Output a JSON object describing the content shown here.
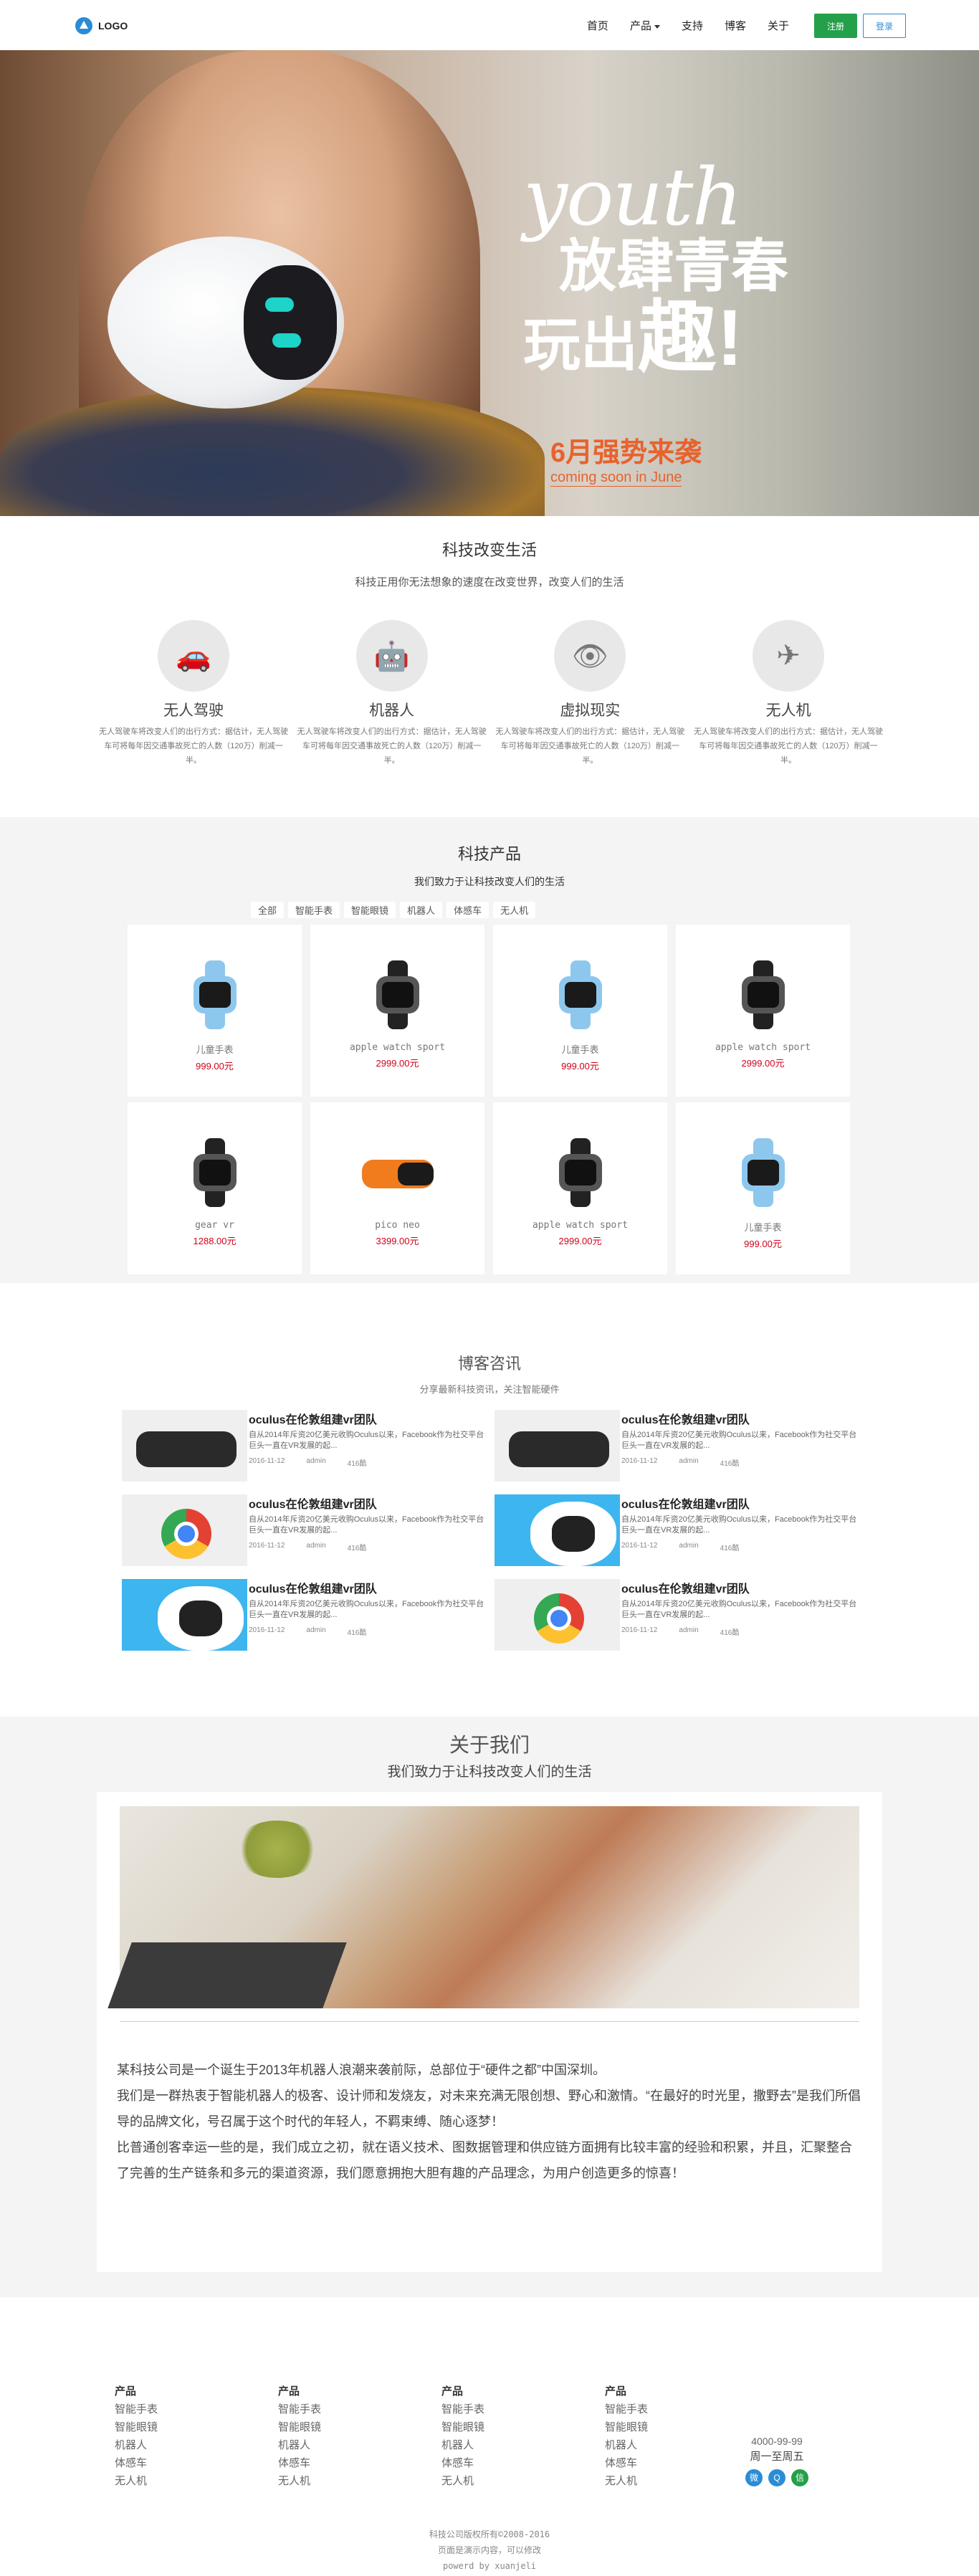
{
  "nav": {
    "logo": "LOGO",
    "items": [
      {
        "label": "首页",
        "dropdown": false
      },
      {
        "label": "产品",
        "dropdown": true
      },
      {
        "label": "支持",
        "dropdown": false
      },
      {
        "label": "博客",
        "dropdown": false
      },
      {
        "label": "关于",
        "dropdown": false
      }
    ],
    "register": "注册",
    "login": "登录"
  },
  "hero": {
    "youth": "youth",
    "line1": "放肆青春",
    "line2a": "玩出",
    "line2b": "趣!",
    "month": "6月强势来袭",
    "coming": "coming soon in June"
  },
  "features": {
    "title": "科技改变生活",
    "subtitle": "科技正用你无法想象的速度在改变世界，改变人们的生活",
    "items": [
      {
        "icon": "car-icon",
        "name": "无人驾驶",
        "desc": "无人驾驶车将改变人们的出行方式：据估计，无人驾驶车可将每年因交通事故死亡的人数（120万）削减一半。"
      },
      {
        "icon": "android-icon",
        "name": "机器人",
        "desc": "无人驾驶车将改变人们的出行方式：据估计，无人驾驶车可将每年因交通事故死亡的人数（120万）削减一半。"
      },
      {
        "icon": "eye-icon",
        "name": "虚拟现实",
        "desc": "无人驾驶车将改变人们的出行方式：据估计，无人驾驶车可将每年因交通事故死亡的人数（120万）削减一半。"
      },
      {
        "icon": "plane-icon",
        "name": "无人机",
        "desc": "无人驾驶车将改变人们的出行方式：据估计，无人驾驶车可将每年因交通事故死亡的人数（120万）削减一半。"
      }
    ]
  },
  "products": {
    "title": "科技产品",
    "subtitle": "我们致力于让科技改变人们的生活",
    "tabs": [
      "全部",
      "智能手表",
      "智能眼镜",
      "机器人",
      "体感车",
      "无人机"
    ],
    "items": [
      {
        "name": "儿童手表",
        "price": "999.00元",
        "kind": "kids-watch"
      },
      {
        "name": "apple watch sport",
        "price": "2999.00元",
        "kind": "apple-watch"
      },
      {
        "name": "儿童手表",
        "price": "999.00元",
        "kind": "kids-watch"
      },
      {
        "name": "apple watch sport",
        "price": "2999.00元",
        "kind": "apple-watch"
      },
      {
        "name": "gear vr",
        "price": "1288.00元",
        "kind": "apple-watch"
      },
      {
        "name": "pico neo",
        "price": "3399.00元",
        "kind": "vr-headset"
      },
      {
        "name": "apple watch sport",
        "price": "2999.00元",
        "kind": "apple-watch"
      },
      {
        "name": "儿童手表",
        "price": "999.00元",
        "kind": "kids-watch"
      }
    ]
  },
  "blog": {
    "title": "博客咨讯",
    "subtitle": "分享最新科技资讯，关注智能硬件",
    "posts": [
      {
        "title": "oculus在伦敦组建vr团队",
        "desc": "自从2014年斥资20亿美元收购Oculus以来，Facebook作为社交平台巨头一直在VR发展的起...",
        "date": "2016-11-12",
        "author": "admin",
        "views": "416酷",
        "thumb": "vr"
      },
      {
        "title": "oculus在伦敦组建vr团队",
        "desc": "自从2014年斥资20亿美元收购Oculus以来，Facebook作为社交平台巨头一直在VR发展的起...",
        "date": "2016-11-12",
        "author": "admin",
        "views": "416酷",
        "thumb": "vr"
      },
      {
        "title": "oculus在伦敦组建vr团队",
        "desc": "自从2014年斥资20亿美元收购Oculus以来，Facebook作为社交平台巨头一直在VR发展的起...",
        "date": "2016-11-12",
        "author": "admin",
        "views": "416酷",
        "thumb": "chrome"
      },
      {
        "title": "oculus在伦敦组建vr团队",
        "desc": "自从2014年斥资20亿美元收购Oculus以来，Facebook作为社交平台巨头一直在VR发展的起...",
        "date": "2016-11-12",
        "author": "admin",
        "views": "416酷",
        "thumb": "robot"
      },
      {
        "title": "oculus在伦敦组建vr团队",
        "desc": "自从2014年斥资20亿美元收购Oculus以来，Facebook作为社交平台巨头一直在VR发展的起...",
        "date": "2016-11-12",
        "author": "admin",
        "views": "416酷",
        "thumb": "robot"
      },
      {
        "title": "oculus在伦敦组建vr团队",
        "desc": "自从2014年斥资20亿美元收购Oculus以来，Facebook作为社交平台巨头一直在VR发展的起...",
        "date": "2016-11-12",
        "author": "admin",
        "views": "416酷",
        "thumb": "chrome"
      }
    ]
  },
  "about": {
    "title": "关于我们",
    "subtitle": "我们致力于让科技改变人们的生活",
    "paragraphs": [
      "某科技公司是一个诞生于2013年机器人浪潮来袭前际，总部位于“硬件之都”中国深圳。",
      "我们是一群热衷于智能机器人的极客、设计师和发烧友，对未来充满无限创想、野心和激情。“在最好的时光里，撒野去”是我们所倡导的品牌文化，号召属于这个时代的年轻人，不羁束缚、随心逐梦！",
      "比普通创客幸运一些的是，我们成立之初，就在语义技术、图数据管理和供应链方面拥有比较丰富的经验和积累，并且，汇聚整合了完善的生产链条和多元的渠道资源，我们愿意拥抱大胆有趣的产品理念，为用户创造更多的惊喜！"
    ]
  },
  "footer": {
    "columns": [
      {
        "head": "产品",
        "links": [
          "智能手表",
          "智能眼镜",
          "机器人",
          "体感车",
          "无人机"
        ]
      },
      {
        "head": "产品",
        "links": [
          "智能手表",
          "智能眼镜",
          "机器人",
          "体感车",
          "无人机"
        ]
      },
      {
        "head": "产品",
        "links": [
          "智能手表",
          "智能眼镜",
          "机器人",
          "体感车",
          "无人机"
        ]
      },
      {
        "head": "产品",
        "links": [
          "智能手表",
          "智能眼镜",
          "机器人",
          "体感车",
          "无人机"
        ]
      }
    ],
    "phone": "4000-99-99",
    "hours": "周一至周五",
    "social": [
      {
        "icon": "weibo-icon",
        "glyph": "微",
        "color": "#2b8cd6"
      },
      {
        "icon": "qq-icon",
        "glyph": "Q",
        "color": "#2b8cd6"
      },
      {
        "icon": "wechat-icon",
        "glyph": "信",
        "color": "#24a04a"
      }
    ],
    "copyright": [
      "科技公司版权所有©2008-2016",
      "页面是演示内容，可以修改",
      "powerd by xuanjeli"
    ]
  },
  "colors": {
    "accent": "#2b8cd6",
    "register_green": "#24a04a",
    "price_red": "#d0021b",
    "hero_orange": "#e8622d"
  }
}
